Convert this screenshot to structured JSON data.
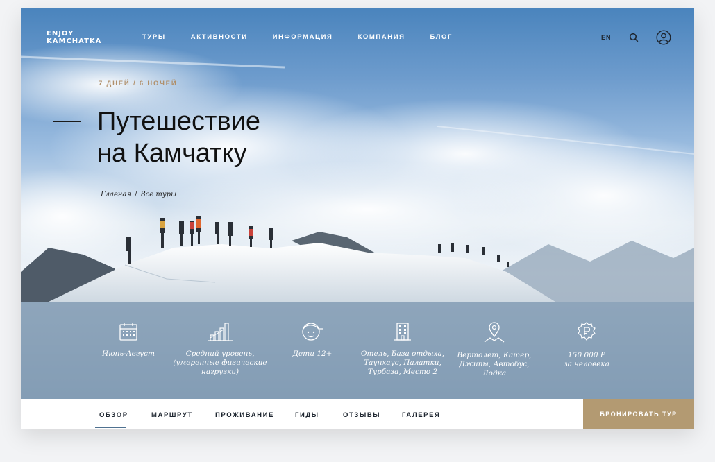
{
  "header": {
    "logo_line1": "ENJOY",
    "logo_line2": "KAMCHATKA",
    "nav": [
      "ТУРЫ",
      "АКТИВНОСТИ",
      "ИНФОРМАЦИЯ",
      "КОМПАНИЯ",
      "БЛОГ"
    ],
    "lang": "EN",
    "icons": [
      "search-icon",
      "user-icon"
    ]
  },
  "hero": {
    "duration": "7 ДНЕЙ / 6 НОЧЕЙ",
    "title_line1": "Путешествие",
    "title_line2": "на Камчатку",
    "breadcrumbs": [
      "Главная",
      "Все туры"
    ],
    "breadcrumb_separator": "/"
  },
  "features": [
    {
      "icon": "calendar-icon",
      "lines": [
        "Июнь-Август"
      ]
    },
    {
      "icon": "bar-chart-icon",
      "lines": [
        "Средний уровень,",
        "(умеренные физические",
        "нагрузки)"
      ]
    },
    {
      "icon": "child-face-icon",
      "lines": [
        "Дети 12+"
      ]
    },
    {
      "icon": "building-icon",
      "lines": [
        "Отель, База отдыха,",
        "Таунхаус, Палатки,",
        "Турбаза, Место 2"
      ]
    },
    {
      "icon": "location-pin-icon",
      "lines": [
        "Вертолет, Катер,",
        "Джипы, Автобус,",
        "Лодка"
      ]
    },
    {
      "icon": "ruble-badge-icon",
      "lines": [
        "150 000 Р",
        "за человека"
      ]
    }
  ],
  "tabs": {
    "items": [
      "ОБЗОР",
      "МАРШРУТ",
      "ПРОЖИВАНИЕ",
      "ГИДЫ",
      "ОТЗЫВЫ",
      "ГАЛЕРЕЯ"
    ],
    "active": "ОБЗОР",
    "book_label": "БРОНИРОВАТЬ ТУР"
  },
  "colors": {
    "accent_gold": "#b39a72",
    "duration_text": "#b08f6a",
    "tab_underline": "#4f7190"
  }
}
